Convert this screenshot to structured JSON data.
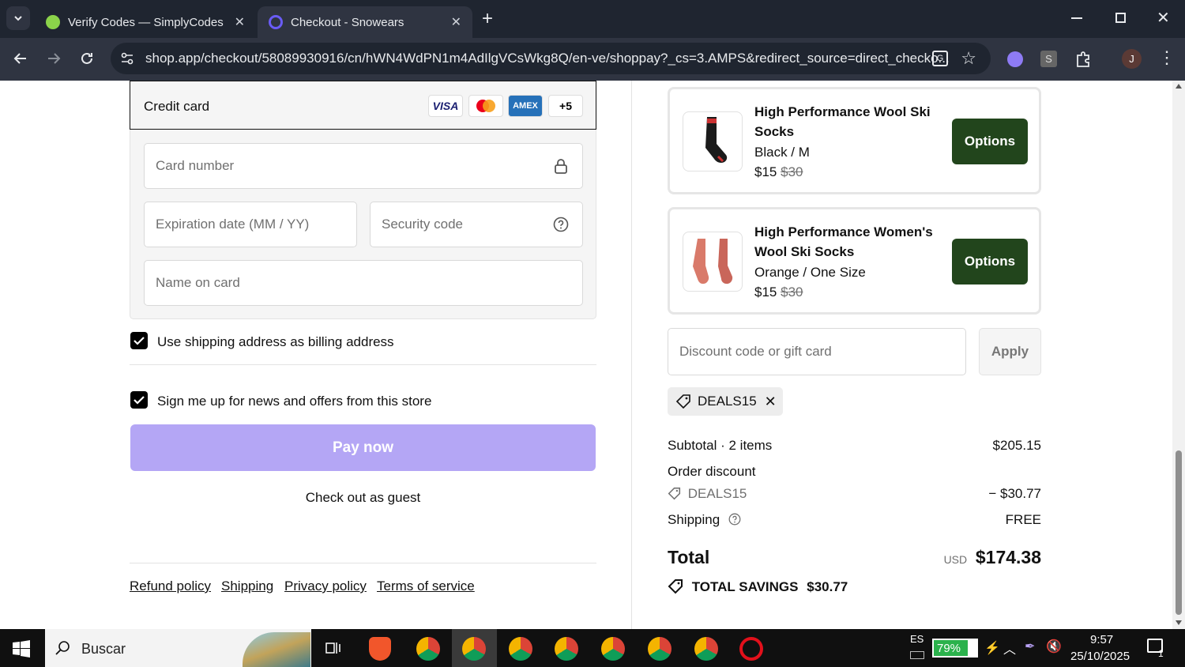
{
  "browser": {
    "tabs": [
      {
        "title": "Verify Codes — SimplyCodes",
        "active": false
      },
      {
        "title": "Checkout - Snowears",
        "active": true
      }
    ],
    "url": "shop.app/checkout/58089930916/cn/hWN4WdPN1m4AdIlgVCsWkg8Q/en-ve/shoppay?_cs=3.AMPS&redirect_source=direct_checko...",
    "profile_initial": "J",
    "ext_letter": "S"
  },
  "payment": {
    "method_label": "Credit card",
    "brands": [
      "VISA",
      "",
      "AMEX",
      "+5"
    ],
    "card_number_placeholder": "Card number",
    "expiry_placeholder": "Expiration date (MM / YY)",
    "security_placeholder": "Security code",
    "name_placeholder": "Name on card"
  },
  "checkboxes": {
    "billing_label": "Use shipping address as billing address",
    "newsletter_label": "Sign me up for news and offers from this store"
  },
  "pay_button": "Pay now",
  "guest_link": "Check out as guest",
  "footer_links": [
    "Refund policy",
    "Shipping",
    "Privacy policy",
    "Terms of service"
  ],
  "products": [
    {
      "name": "High Performance Wool Ski Socks",
      "variant": "Black / M",
      "price": "$15",
      "compare_price": "$30",
      "button": "Options"
    },
    {
      "name": "High Performance Women's Wool Ski Socks",
      "variant": "Orange / One Size",
      "price": "$15",
      "compare_price": "$30",
      "button": "Options"
    }
  ],
  "discount": {
    "placeholder": "Discount code or gift card",
    "apply_label": "Apply",
    "applied_code": "DEALS15"
  },
  "summary": {
    "subtotal_label": "Subtotal · 2 items",
    "subtotal_value": "$205.15",
    "order_discount_label": "Order discount",
    "discount_code": "DEALS15",
    "discount_value": "− $30.77",
    "shipping_label": "Shipping",
    "shipping_value": "FREE",
    "total_label": "Total",
    "currency": "USD",
    "total_value": "$174.38",
    "savings_label": "TOTAL SAVINGS",
    "savings_value": "$30.77"
  },
  "taskbar": {
    "search_placeholder": "Buscar",
    "language": "ES",
    "battery": "79%",
    "time": "9:57",
    "date": "25/10/2025",
    "notifications": "1"
  },
  "colors": {
    "accent_green": "#22451c",
    "pay_button_bg": "#b4a6f5",
    "chrome_dark": "#1f2530"
  }
}
